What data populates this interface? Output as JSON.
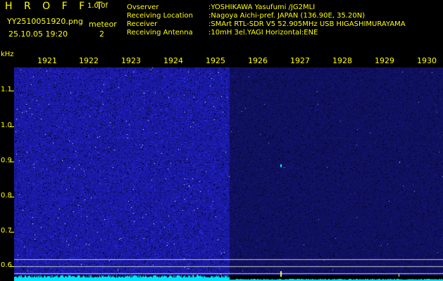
{
  "header": {
    "app_title": "H R O F F T",
    "version": "1.0.0f",
    "file_name": "YY2510051920.png",
    "timestamp": "25.10.05 19:20",
    "meteor_label": "meteor",
    "meteor_count": "2"
  },
  "info": [
    {
      "label": "Ovserver",
      "value": ":YOSHIKAWA Yasufumi /JG2MLI"
    },
    {
      "label": "Receiving Location",
      "value": ":Nagoya Aichi-pref. JAPAN (136.90E, 35.20N)"
    },
    {
      "label": "Receiver",
      "value": ":SMArt RTL-SDR V5 52.905MHz USB HIGASHIMURAYAMA"
    },
    {
      "label": "Receiving Antenna",
      "value": ":10mH 3el.YAGI Horizontal:ENE"
    }
  ],
  "axis": {
    "unit": "kHz",
    "freq_ticks": [
      "1.1",
      "1.0",
      "0.9",
      "0.8",
      "0.7",
      "0.6"
    ],
    "minute_labels": [
      "1921",
      "1922",
      "1923",
      "1924",
      "1925",
      "1926",
      "1927",
      "1928",
      "1929",
      "1930"
    ]
  },
  "colors": {
    "background": "#000000",
    "text": "#ffff00",
    "noise_dense": "#1a1aa8",
    "noise_sparse": "#101060",
    "baseline": "#00e5ff",
    "marker_line": "#c8c8c8",
    "meteor": "#00ffff"
  }
}
